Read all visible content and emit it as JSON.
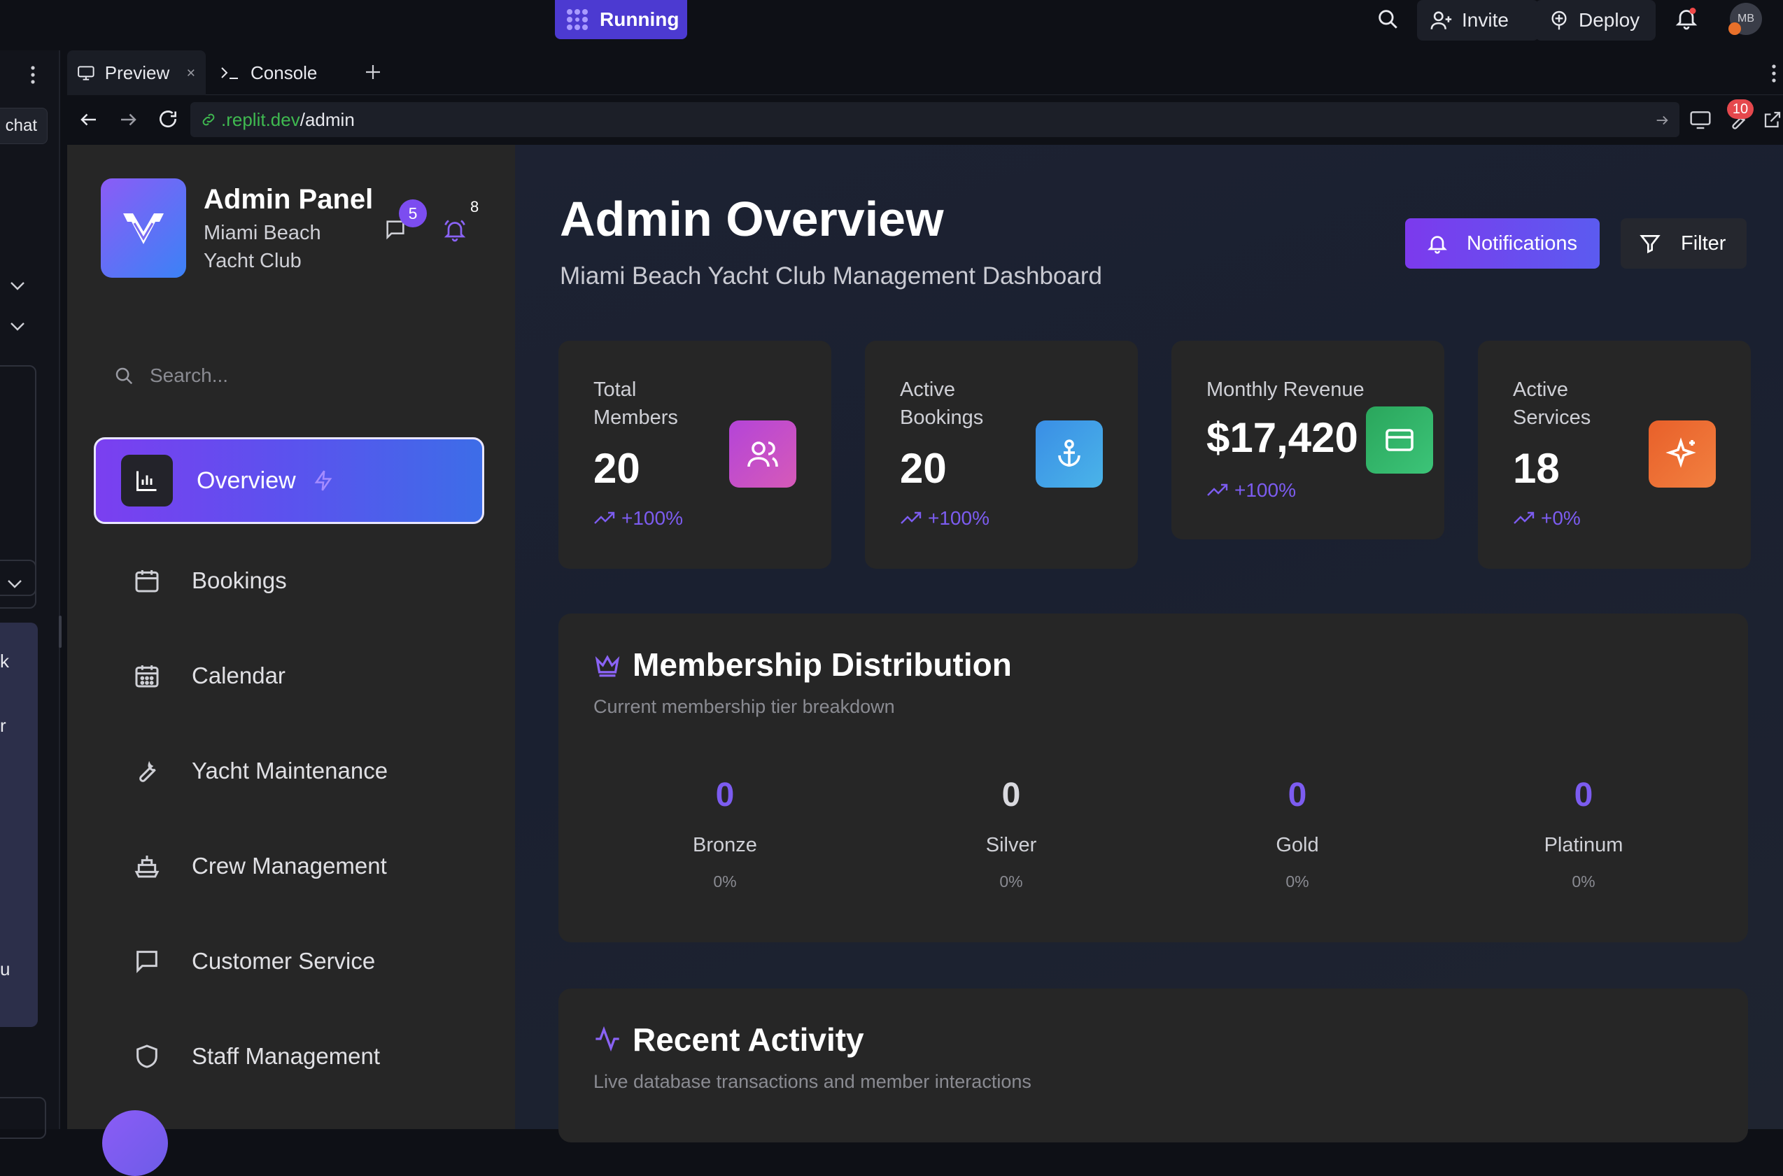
{
  "topbar": {
    "run_label": "Running",
    "invite_label": "Invite",
    "deploy_label": "Deploy",
    "avatar_initials": "MB"
  },
  "leftstrip": {
    "chat_label": "chat",
    "frag1": "k",
    "frag2": "r",
    "frag3": "u"
  },
  "tabs": [
    {
      "label": "Preview"
    },
    {
      "label": "Console"
    }
  ],
  "url": {
    "domain": ".replit.dev",
    "path": "/admin",
    "badge": "10"
  },
  "sidebar": {
    "title": "Admin Panel",
    "subtitle_line1": "Miami Beach",
    "subtitle_line2": "Yacht Club",
    "messages_badge": "5",
    "alerts_count": "8",
    "search_placeholder": "Search...",
    "nav": [
      {
        "label": "Overview",
        "icon": "bar-chart-icon"
      },
      {
        "label": "Bookings",
        "icon": "calendar-icon"
      },
      {
        "label": "Calendar",
        "icon": "calendar-grid-icon"
      },
      {
        "label": "Yacht Maintenance",
        "icon": "wrench-icon"
      },
      {
        "label": "Crew Management",
        "icon": "ship-icon"
      },
      {
        "label": "Customer Service",
        "icon": "message-icon"
      },
      {
        "label": "Staff Management",
        "icon": "shield-icon"
      }
    ]
  },
  "main": {
    "title": "Admin Overview",
    "subtitle": "Miami Beach Yacht Club Management Dashboard",
    "notifications_label": "Notifications",
    "filter_label": "Filter",
    "stats": [
      {
        "label_line1": "Total",
        "label_line2": "Members",
        "value": "20",
        "change": "+100%",
        "icon": "users-icon",
        "color": "#c04fd6"
      },
      {
        "label_line1": "Active",
        "label_line2": "Bookings",
        "value": "20",
        "change": "+100%",
        "icon": "anchor-icon",
        "color": "#3b8fe0"
      },
      {
        "label_line1": "Monthly Revenue",
        "label_line2": "",
        "value": "$17,420",
        "change": "+100%",
        "icon": "credit-card-icon",
        "color": "#2fb36a"
      },
      {
        "label_line1": "Active",
        "label_line2": "Services",
        "value": "18",
        "change": "+0%",
        "icon": "sparkle-icon",
        "color": "#ec6a2c"
      }
    ],
    "membership": {
      "title": "Membership Distribution",
      "subtitle": "Current membership tier breakdown",
      "tiers": [
        {
          "count": "0",
          "name": "Bronze",
          "pct": "0%",
          "color": "#7c5cf0"
        },
        {
          "count": "0",
          "name": "Silver",
          "pct": "0%",
          "color": "#d9d9de"
        },
        {
          "count": "0",
          "name": "Gold",
          "pct": "0%",
          "color": "#7c5cf0"
        },
        {
          "count": "0",
          "name": "Platinum",
          "pct": "0%",
          "color": "#7c5cf0"
        }
      ]
    },
    "activity": {
      "title": "Recent Activity",
      "subtitle": "Live database transactions and member interactions"
    }
  }
}
